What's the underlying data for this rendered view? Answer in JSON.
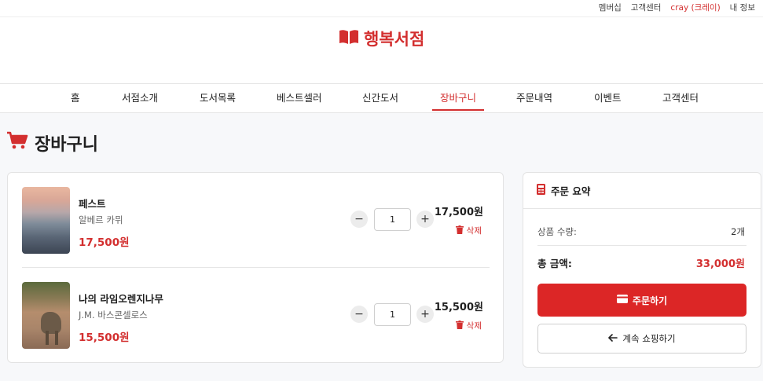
{
  "topbar": {
    "membership": "멤버십",
    "support": "고객센터",
    "user": "cray (크레이)",
    "myinfo": "내 정보"
  },
  "header": {
    "logo_text": "행복서점",
    "logo_icon": "book-open-icon",
    "brand_color": "#d32f2f"
  },
  "nav": {
    "items": [
      {
        "label": "홈"
      },
      {
        "label": "서점소개"
      },
      {
        "label": "도서목록"
      },
      {
        "label": "베스트셀러"
      },
      {
        "label": "신간도서"
      },
      {
        "label": "장바구니",
        "active": true
      },
      {
        "label": "주문내역"
      },
      {
        "label": "이벤트"
      },
      {
        "label": "고객센터"
      }
    ]
  },
  "page": {
    "title": "장바구니",
    "title_icon": "cart-icon"
  },
  "cart": {
    "items": [
      {
        "title": "페스트",
        "author": "알베르 카뮈",
        "price": "17,500원",
        "qty": "1",
        "line_total": "17,500원",
        "delete_label": "삭제"
      },
      {
        "title": "나의 라임오렌지나무",
        "author": "J.M. 바스콘셀로스",
        "price": "15,500원",
        "qty": "1",
        "line_total": "15,500원",
        "delete_label": "삭제"
      }
    ],
    "minus_symbol": "−",
    "plus_symbol": "+"
  },
  "summary": {
    "title": "주문 요약",
    "title_icon": "calculator-icon",
    "qty_label": "상품 수량:",
    "qty_value": "2개",
    "total_label": "총 금액:",
    "total_value": "33,000원",
    "order_button": "주문하기",
    "continue_button": "계속 쇼핑하기"
  },
  "colors": {
    "accent": "#dc2626",
    "price": "#d32f2f"
  }
}
